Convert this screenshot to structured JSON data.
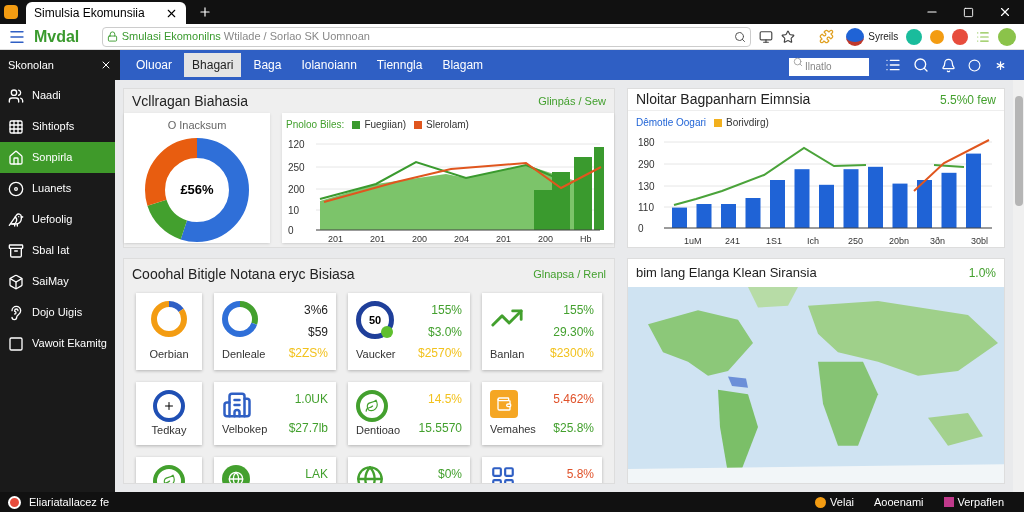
{
  "browser": {
    "tab_title": "Simulsia Ekomunsiia",
    "logo": "Mvdal",
    "url_site": "Smulasi Ekomonilns",
    "url_path": "Wtilade / Sorlao SK Uomnoan",
    "profile_label": "Syreils"
  },
  "sidebar": {
    "title": "Skonolan",
    "items": [
      {
        "label": "Naadi",
        "selected": false
      },
      {
        "label": "Sihtiopfs",
        "selected": false
      },
      {
        "label": "Sonpirla",
        "selected": true
      },
      {
        "label": "Luanets",
        "selected": false
      },
      {
        "label": "Uefoolig",
        "selected": false
      },
      {
        "label": "Sbal Iat",
        "selected": false
      },
      {
        "label": "SaiMay",
        "selected": false
      },
      {
        "label": "Dojo Uigis",
        "selected": false
      },
      {
        "label": "Vawoit Ekamitg",
        "selected": false
      }
    ]
  },
  "nav": {
    "tabs": [
      {
        "label": "Oluoar",
        "selected": false
      },
      {
        "label": "Bhagari",
        "selected": true
      },
      {
        "label": "Baga",
        "selected": false
      },
      {
        "label": "Iolanoiann",
        "selected": false
      },
      {
        "label": "Tienngla",
        "selected": false
      },
      {
        "label": "Blagam",
        "selected": false
      }
    ],
    "search_placeholder": "Ilnatlo"
  },
  "overview_card": {
    "title": "Vcllragan Biahasia",
    "link": "Glinpás / Sew",
    "donut": {
      "title": "O Inacksum",
      "center": "£56%"
    },
    "chart": {
      "legend_title": "Pnoloo Biles:",
      "legend": [
        {
          "label": "Fuegiian)",
          "color": "#3a9a2e"
        },
        {
          "label": "Slerolam)",
          "color": "#e0561e"
        }
      ],
      "y_labels": [
        "120",
        "250",
        "200",
        "10",
        "0"
      ],
      "x_labels": [
        "201",
        "201",
        "200",
        "204",
        "201",
        "200",
        "Hb"
      ]
    }
  },
  "trend_card": {
    "title": "Nloitar Bagpanharn Eimnsia",
    "figure": "5.5%0 few",
    "chart": {
      "legend_title": "Dêmotle Oogari",
      "legend": [
        {
          "label": "Borivdirg)",
          "color": "#f2b01e"
        }
      ],
      "y_labels": [
        "180",
        "290",
        "130",
        "110",
        "0"
      ],
      "x_labels": [
        "1uM",
        "241",
        "1S1",
        "Ich",
        "250",
        "20bn",
        "3ðn",
        "30bl"
      ]
    }
  },
  "metrics_card": {
    "title": "Cooohal Bitigle Notana eryc Bisiasa",
    "link": "Glnapsa / Renl",
    "tiles": [
      {
        "kind": "label",
        "label": "Oerbian"
      },
      {
        "kind": "stats",
        "label": "Denleale",
        "values": [
          {
            "text": "3%6",
            "color": "#222222"
          },
          {
            "text": "$59",
            "color": "#222222"
          },
          {
            "text": "$2ZS%",
            "color": "#f2c21e"
          }
        ]
      },
      {
        "kind": "stats",
        "label": "Vaucker",
        "badge": "50",
        "values": [
          {
            "text": "155%",
            "color": "#43a02e"
          },
          {
            "text": "$3.0%",
            "color": "#43a02e"
          },
          {
            "text": "$2570%",
            "color": "#f2c21e"
          }
        ]
      },
      {
        "kind": "stats",
        "label": "Banlan",
        "values": [
          {
            "text": "155%",
            "color": "#43a02e"
          },
          {
            "text": "29.30%",
            "color": "#43a02e"
          },
          {
            "text": "$2300%",
            "color": "#f2c21e"
          }
        ]
      },
      {
        "kind": "label",
        "label": "Tedkay"
      },
      {
        "kind": "stats",
        "label": "Velbokep",
        "values": [
          {
            "text": "1.0UK",
            "color": "#43a02e"
          },
          {
            "text": "$27.7lb",
            "color": "#43a02e"
          }
        ]
      },
      {
        "kind": "stats",
        "label": "Dentioao",
        "values": [
          {
            "text": "14.5%",
            "color": "#f2c21e"
          },
          {
            "text": "15.5570",
            "color": "#43a02e"
          }
        ]
      },
      {
        "kind": "stats",
        "label": "Vemahes",
        "values": [
          {
            "text": "5.462%",
            "color": "#e0522a"
          },
          {
            "text": "$25.8%",
            "color": "#43a02e"
          }
        ]
      },
      {
        "kind": "label"
      },
      {
        "kind": "stats",
        "values": [
          {
            "text": "LAK",
            "color": "#43a02e"
          }
        ]
      },
      {
        "kind": "stats",
        "values": [
          {
            "text": "$0%",
            "color": "#43a02e"
          }
        ]
      },
      {
        "kind": "stats",
        "values": [
          {
            "text": "5.8%",
            "color": "#e0522a"
          }
        ]
      }
    ]
  },
  "map_card": {
    "title": "bim lang Elanga Klean Siransia",
    "figure": "1.0%"
  },
  "status_bar": {
    "left": "Eliariatallacez fe",
    "right": [
      "Velai",
      "Aooenami",
      "Verpaflen"
    ]
  }
}
